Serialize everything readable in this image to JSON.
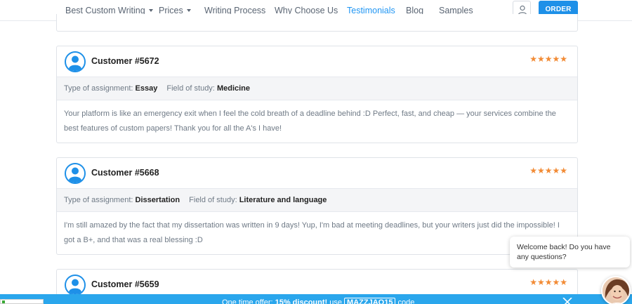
{
  "nav": {
    "items": [
      {
        "label": "Best Custom Writing",
        "dropdown": true
      },
      {
        "label": "Prices",
        "dropdown": true
      },
      {
        "label": "Writing Process",
        "dropdown": false
      },
      {
        "label": "Why Choose Us",
        "dropdown": false
      },
      {
        "label": "Testimonials",
        "dropdown": false,
        "active": true
      },
      {
        "label": "Blog",
        "dropdown": false
      },
      {
        "label": "Samples",
        "dropdown": false
      }
    ],
    "user_icon": "user-icon",
    "order_label": "ORDER"
  },
  "reviews": [
    {
      "customer": "Customer #5672",
      "stars": 5,
      "assignment_label": "Type of assignment:",
      "assignment": "Essay",
      "field_label": "Field of study:",
      "field": "Medicine",
      "text": "Your platform is like an emergency exit when I feel the cold breath of a deadline behind :D Perfect, fast, and cheap — your services combine the best features of custom papers! Thank you for all the A's I have!"
    },
    {
      "customer": "Customer #5668",
      "stars": 5,
      "assignment_label": "Type of assignment:",
      "assignment": "Dissertation",
      "field_label": "Field of study:",
      "field": "Literature and language",
      "text": "I'm still amazed by the fact that my dissertation was written in 9 days! Yup, I'm bad at meeting deadlines, but your writers just did the impossible! I got a B+, and that was a real blessing :D"
    },
    {
      "customer": "Customer #5659",
      "stars": 5
    }
  ],
  "promo": {
    "prefix": "One time offer: ",
    "discount": "15% discount!",
    "middle": " use ",
    "code": "MAZZJAO15",
    "suffix": " code"
  },
  "chat": {
    "message": "Welcome back! Do you have any questions?"
  },
  "colors": {
    "accent": "#2196f3",
    "order_button": "#1e90e8",
    "stars": "#f28b35",
    "promo_bar": "#2aa6ec"
  }
}
